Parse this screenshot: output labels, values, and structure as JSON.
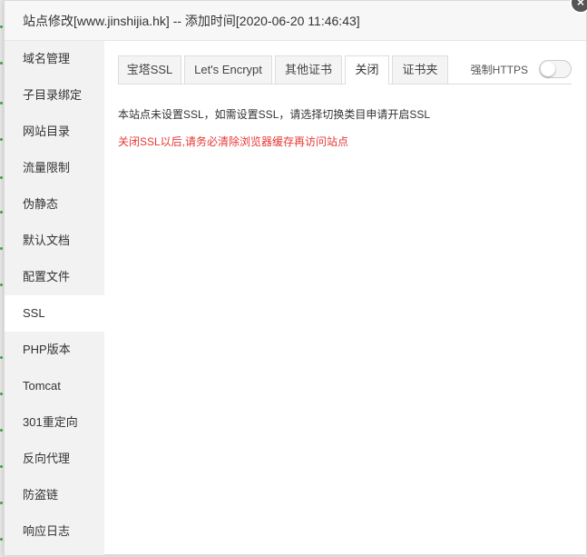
{
  "dialog": {
    "title": "站点修改[www.jinshijia.hk] -- 添加时间[2020-06-20 11:46:43]",
    "close_label": "×"
  },
  "sidebar": {
    "items": [
      {
        "label": "域名管理"
      },
      {
        "label": "子目录绑定"
      },
      {
        "label": "网站目录"
      },
      {
        "label": "流量限制"
      },
      {
        "label": "伪静态"
      },
      {
        "label": "默认文档"
      },
      {
        "label": "配置文件"
      },
      {
        "label": "SSL"
      },
      {
        "label": "PHP版本"
      },
      {
        "label": "Tomcat"
      },
      {
        "label": "301重定向"
      },
      {
        "label": "反向代理"
      },
      {
        "label": "防盗链"
      },
      {
        "label": "响应日志"
      }
    ],
    "active_item": "SSL"
  },
  "tabs": [
    {
      "label": "宝塔SSL"
    },
    {
      "label": "Let's Encrypt"
    },
    {
      "label": "其他证书"
    },
    {
      "label": "关闭"
    },
    {
      "label": "证书夹"
    }
  ],
  "active_tab": "关闭",
  "force_https": {
    "label": "强制HTTPS",
    "enabled": false
  },
  "messages": {
    "info": "本站点未设置SSL，如需设置SSL，请选择切换类目申请开启SSL",
    "warning": "关闭SSL以后,请务必清除浏览器缓存再访问站点"
  },
  "colors": {
    "warning": "#e53935",
    "sidebar_bg": "#f2f2f2",
    "active_bg": "#ffffff"
  }
}
